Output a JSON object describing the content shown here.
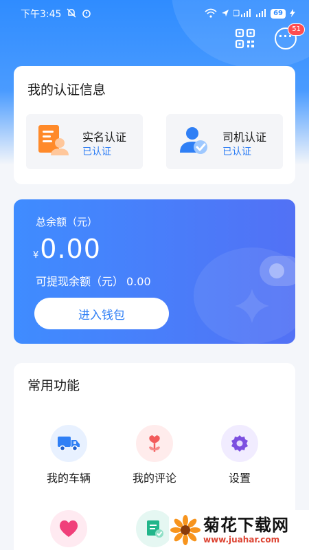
{
  "status_bar": {
    "time": "下午3:45",
    "battery": "69"
  },
  "header": {
    "badge_count": "51"
  },
  "auth": {
    "title": "我的认证信息",
    "items": [
      {
        "name": "实名认证",
        "status": "已认证",
        "icon": "id-card-icon"
      },
      {
        "name": "司机认证",
        "status": "已认证",
        "icon": "driver-verified-icon"
      }
    ]
  },
  "wallet": {
    "label": "总余额（元）",
    "currency": "¥",
    "amount": "0.00",
    "withdraw_label": "可提现余额（元）",
    "withdraw_value": "0.00",
    "button": "进入钱包"
  },
  "functions": {
    "title": "常用功能",
    "items": [
      {
        "label": "我的车辆",
        "icon": "truck-icon"
      },
      {
        "label": "我的评论",
        "icon": "flower-heart-icon"
      },
      {
        "label": "设置",
        "icon": "gear-icon"
      },
      {
        "label": "",
        "icon": "heart-icon"
      },
      {
        "label": "",
        "icon": "document-check-icon"
      }
    ]
  },
  "watermark": {
    "title": "菊花下载网",
    "url": "www.juahar.com"
  },
  "colors": {
    "primary": "#2f7ff5",
    "badge": "#ff4d4f",
    "wallet_start": "#3f8cff",
    "wallet_end": "#5271f5"
  }
}
